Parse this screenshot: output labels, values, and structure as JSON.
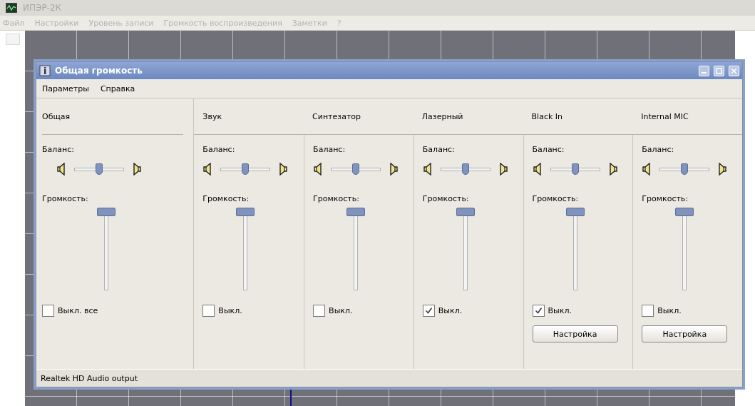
{
  "app": {
    "title": "ИПЭР-2К",
    "active": false,
    "menu": [
      "Файл",
      "Настройки",
      "Уровень записи",
      "Громкость воспроизведения",
      "Заметки",
      "?"
    ]
  },
  "mixer": {
    "title": "Общая громкость",
    "menu": [
      "Параметры",
      "Справка"
    ],
    "channels": [
      {
        "kind": "master",
        "name": "Общая",
        "balance_label": "Баланс:",
        "balance": {
          "level": 0.5
        },
        "volume_label": "Громкость:",
        "volume": {
          "level": 1
        },
        "mute_label": "Выкл. все",
        "muted": false
      },
      {
        "kind": "line",
        "name": "Звук",
        "balance_label": "Баланс:",
        "balance": {
          "level": 0.5
        },
        "volume_label": "Громкость:",
        "volume": {
          "level": 1
        },
        "mute_label": "Выкл.",
        "muted": false
      },
      {
        "kind": "line",
        "name": "Синтезатор",
        "balance_label": "Баланс:",
        "balance": {
          "level": 0.5
        },
        "volume_label": "Громкость:",
        "volume": {
          "level": 1
        },
        "mute_label": "Выкл.",
        "muted": false
      },
      {
        "kind": "line",
        "name": "Лазерный",
        "balance_label": "Баланс:",
        "balance": {
          "level": 0.5
        },
        "volume_label": "Громкость:",
        "volume": {
          "level": 1
        },
        "mute_label": "Выкл.",
        "muted": true
      },
      {
        "kind": "line",
        "name": "Black In",
        "balance_label": "Баланс:",
        "balance": {
          "level": 0.5
        },
        "volume_label": "Громкость:",
        "volume": {
          "level": 1
        },
        "mute_label": "Выкл.",
        "muted": true,
        "button": "Настройка"
      },
      {
        "kind": "line",
        "name": "Internal MIC",
        "balance_label": "Баланс:",
        "balance": {
          "level": 0.5
        },
        "volume_label": "Громкость:",
        "volume": {
          "level": 1
        },
        "mute_label": "Выкл.",
        "muted": false,
        "button": "Настройка"
      }
    ],
    "status": "Realtek HD Audio output"
  }
}
